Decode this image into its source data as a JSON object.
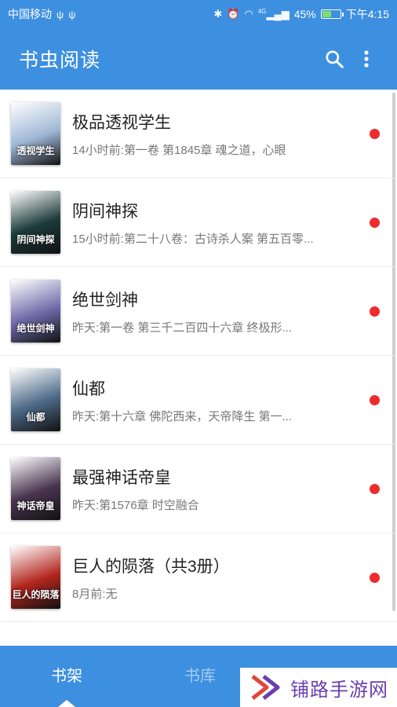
{
  "status_bar": {
    "carrier": "中国移动",
    "battery_percent": "45%",
    "battery_level": 0.45,
    "time": "下午4:15",
    "signal_text": "4G"
  },
  "app_bar": {
    "title": "书虫阅读",
    "search_icon": "search-icon",
    "more_icon": "more-vert-icon"
  },
  "books": [
    {
      "title": "极品透视学生",
      "subtitle": "14小时前:第一卷 第1845章 魂之道，心眼",
      "cover_text": "透视学生",
      "cover_color": "#9fb7d6",
      "unread": true
    },
    {
      "title": "阴间神探",
      "subtitle": "15小时前:第二十八卷：古诗杀人案 第五百零...",
      "cover_text": "阴间神探",
      "cover_color": "#1d3a3a",
      "unread": true
    },
    {
      "title": "绝世剑神",
      "subtitle": "昨天:第一卷 第三千二百四十六章 终极形...",
      "cover_text": "绝世剑神",
      "cover_color": "#6f6aa8",
      "unread": true
    },
    {
      "title": "仙都",
      "subtitle": "昨天:第十六章 佛陀西来，天帝降生 第一...",
      "cover_text": "仙都",
      "cover_color": "#4d6a88",
      "unread": true
    },
    {
      "title": "最强神话帝皇",
      "subtitle": "昨天:第1576章 时空融合",
      "cover_text": "神话帝皇",
      "cover_color": "#4a3550",
      "unread": true
    },
    {
      "title": "巨人的陨落（共3册）",
      "subtitle": "8月前:无",
      "cover_text": "巨人的陨落",
      "cover_color": "#b3261e",
      "unread": true
    }
  ],
  "bottom_nav": {
    "tabs": [
      {
        "label": "书架",
        "active": true
      },
      {
        "label": "书库",
        "active": false
      }
    ]
  },
  "watermark": {
    "text": "铺路手游网"
  },
  "colors": {
    "primary": "#3d8fe0",
    "unread_dot": "#ef2b2b",
    "watermark": "#6a3fb1"
  }
}
